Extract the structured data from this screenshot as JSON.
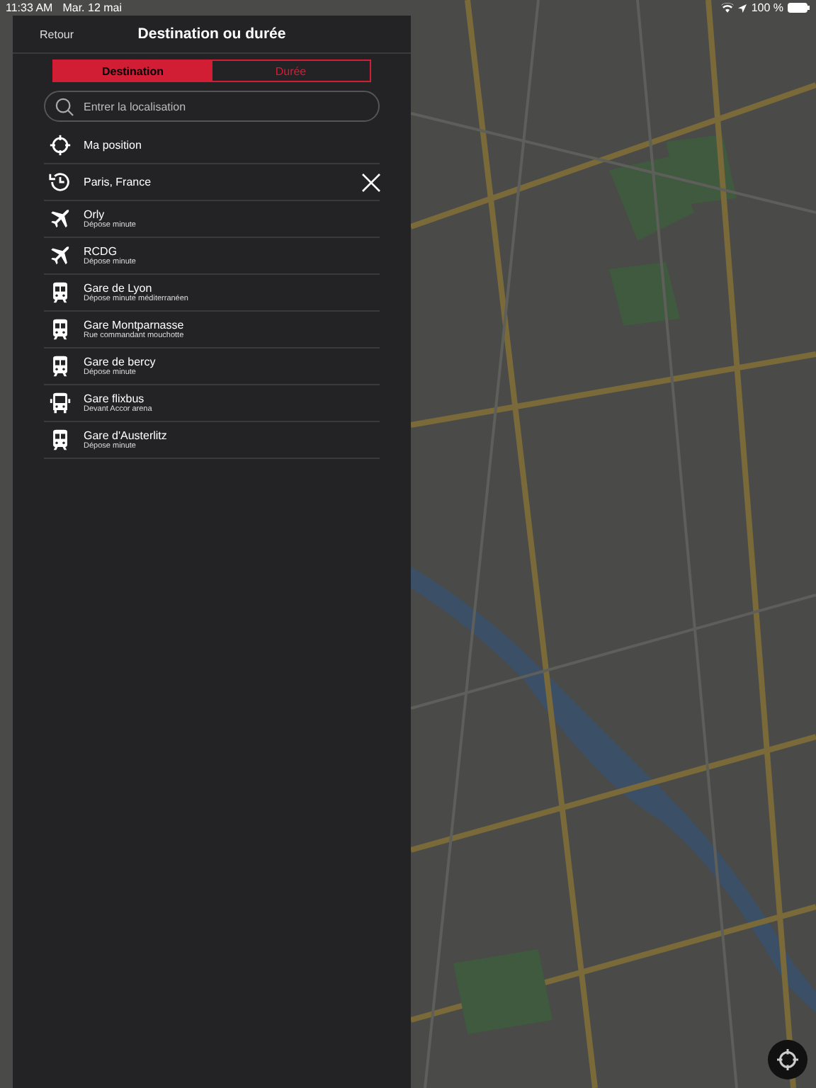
{
  "status_bar": {
    "time": "11:33 AM",
    "date": "Mar. 12 mai",
    "battery": "100 %"
  },
  "panel": {
    "back": "Retour",
    "title": "Destination ou durée",
    "tabs": [
      {
        "label": "Destination",
        "selected": true
      },
      {
        "label": "Durée",
        "selected": false
      }
    ],
    "search": {
      "placeholder": "Entrer la localisation"
    },
    "items": [
      {
        "kind": "location",
        "title": "Ma position"
      },
      {
        "kind": "recent",
        "title": "Paris, France"
      },
      {
        "kind": "plane",
        "title": "Orly",
        "subtitle": "Dépose minute"
      },
      {
        "kind": "plane",
        "title": "RCDG",
        "subtitle": "Dépose minute"
      },
      {
        "kind": "train",
        "title": "Gare de Lyon",
        "subtitle": "Dépose minute méditerranéen"
      },
      {
        "kind": "train",
        "title": "Gare Montparnasse",
        "subtitle": "Rue commandant mouchotte"
      },
      {
        "kind": "train",
        "title": "Gare de bercy",
        "subtitle": "Dépose minute"
      },
      {
        "kind": "bus",
        "title": "Gare flixbus",
        "subtitle": "Devant Accor arena"
      },
      {
        "kind": "train",
        "title": "Gare d'Austerlitz",
        "subtitle": "Dépose minute"
      }
    ]
  }
}
